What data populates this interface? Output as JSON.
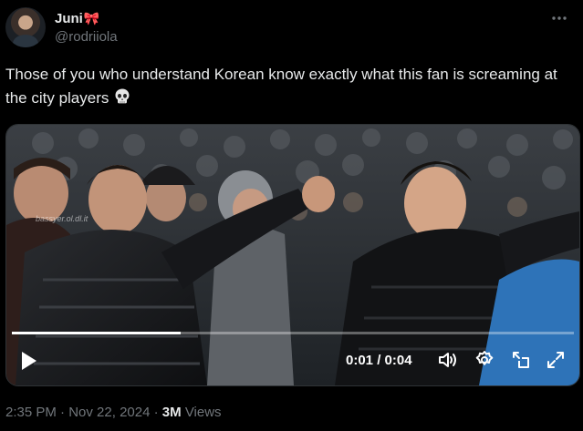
{
  "author": {
    "display_name": "Juni",
    "bow_emoji": "🎀",
    "handle": "@rodriiola"
  },
  "more_icon": "more-horizontal-icon",
  "tweet_text": "Those of you who understand Korean know exactly what this fan is screaming at the city players",
  "emoji": "skull-icon",
  "video": {
    "current_time": "0:01",
    "duration": "0:04",
    "time_separator": " / ",
    "progress": 0.3,
    "controls": [
      "play-icon",
      "volume-icon",
      "settings-icon",
      "pip-icon",
      "fullscreen-icon"
    ]
  },
  "footer": {
    "time": "2:35 PM",
    "separator": "·",
    "date": "Nov 22, 2024",
    "views_count": "3M",
    "views_label": "Views"
  }
}
